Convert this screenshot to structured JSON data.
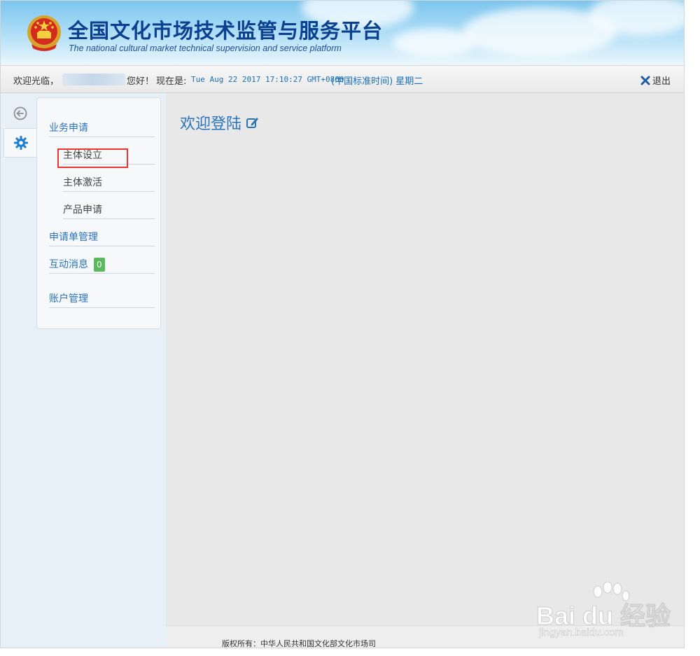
{
  "header": {
    "title": "全国文化市场技术监管与服务平台",
    "subtitle": "The national cultural market technical supervision and service platform",
    "emblem_icon": "national-emblem-icon"
  },
  "statusbar": {
    "welcome": "欢迎光临，",
    "hello": "您好！",
    "now_label": "现在是:",
    "datetime": "Tue Aug 22 2017 17:10:27 GMT+0800",
    "timezone": "(中国标准时间) 星期二",
    "logout_label": "退出"
  },
  "sidebar": {
    "tabs": [
      {
        "icon": "back-arrow-icon"
      },
      {
        "icon": "gear-icon"
      }
    ],
    "menu": [
      {
        "label": "业务申请",
        "type": "section"
      },
      {
        "label": "主体设立",
        "type": "sub"
      },
      {
        "label": "主体激活",
        "type": "sub"
      },
      {
        "label": "产品申请",
        "type": "sub"
      },
      {
        "label": "申请单管理",
        "type": "section"
      },
      {
        "label": "互动消息",
        "type": "section",
        "badge": "0"
      },
      {
        "label": "账户管理",
        "type": "section"
      }
    ]
  },
  "main": {
    "title": "欢迎登陆",
    "title_icon": "edit-icon"
  },
  "footer": {
    "copyright": "版权所有：中华人民共和国文化部文化市场司"
  },
  "watermark": {
    "main": "Bai du 经验",
    "sub": "jingyan.baidu.com"
  },
  "colors": {
    "accent": "#2a73c0",
    "title": "#0b3f8f",
    "badge": "#5cb85c",
    "highlight": "#ee3333"
  }
}
